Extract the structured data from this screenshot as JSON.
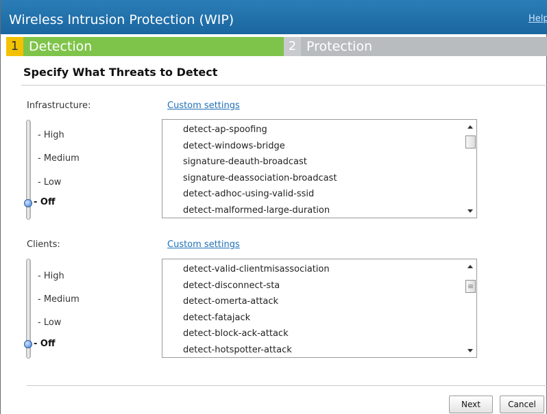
{
  "window": {
    "title": "Wireless Intrusion Protection (WIP)",
    "help_link": "Help"
  },
  "steps": [
    {
      "number": "1",
      "label": "Detection",
      "active": true
    },
    {
      "number": "2",
      "label": "Protection",
      "active": false
    }
  ],
  "section": {
    "title": "Specify What Threats to Detect"
  },
  "infrastructure": {
    "label": "Infrastructure:",
    "custom_link": "Custom settings",
    "levels": [
      "- High",
      "- Medium",
      "- Low",
      "- Off"
    ],
    "selected_level": "- Off",
    "items": [
      "detect-ap-spoofing",
      "detect-windows-bridge",
      "signature-deauth-broadcast",
      "signature-deassociation-broadcast",
      "detect-adhoc-using-valid-ssid",
      "detect-malformed-large-duration"
    ]
  },
  "clients": {
    "label": "Clients:",
    "custom_link": "Custom settings",
    "levels": [
      "- High",
      "- Medium",
      "- Low",
      "- Off"
    ],
    "selected_level": "- Off",
    "items": [
      "detect-valid-clientmisassociation",
      "detect-disconnect-sta",
      "detect-omerta-attack",
      "detect-fatajack",
      "detect-block-ack-attack",
      "detect-hotspotter-attack"
    ]
  },
  "buttons": {
    "next": "Next",
    "cancel": "Cancel"
  },
  "colors": {
    "titlebar": "#1e6fa8",
    "active_step": "#7fc44a",
    "inactive_step": "#b9bcbf",
    "step_number_active": "#f2c200",
    "link": "#1d6fb8"
  }
}
